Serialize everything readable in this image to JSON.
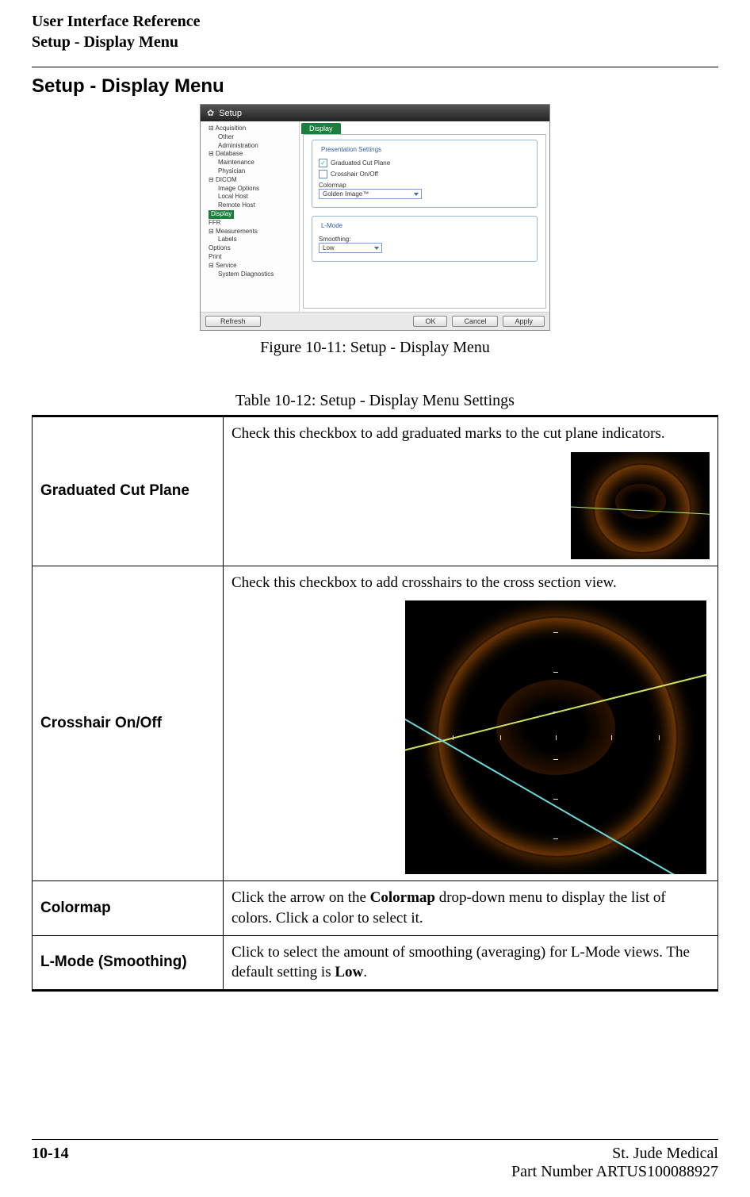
{
  "header": {
    "line1": "User Interface Reference",
    "line2": "Setup - Display Menu"
  },
  "section_heading": "Setup - Display Menu",
  "dialog": {
    "title": "Setup",
    "tree": {
      "acquisition": "Acquisition",
      "other": "Other",
      "administration": "Administration",
      "database": "Database",
      "maintenance": "Maintenance",
      "physician": "Physician",
      "dicom": "DICOM",
      "image_options": "Image Options",
      "local_host": "Local Host",
      "remote_host": "Remote Host",
      "display": "Display",
      "ffr": "FFR",
      "measurements": "Measurements",
      "labels": "Labels",
      "options": "Options",
      "print": "Print",
      "service": "Service",
      "system_diagnostics": "System Diagnostics"
    },
    "tab_label": "Display",
    "presentation_legend": "Presentation Settings",
    "chk_graduated": "Graduated Cut Plane",
    "chk_crosshair": "Crosshair On/Off",
    "colormap_label": "Colormap",
    "colormap_value": "Golden Image™",
    "lmode_legend": "L-Mode",
    "smoothing_label": "Smoothing:",
    "smoothing_value": "Low",
    "btn_refresh": "Refresh",
    "btn_ok": "OK",
    "btn_cancel": "Cancel",
    "btn_apply": "Apply"
  },
  "figure_caption": "Figure 10-11:  Setup - Display Menu",
  "table_caption": "Table 10-12:  Setup - Display Menu Settings",
  "rows": {
    "graduated": {
      "label": "Graduated Cut Plane",
      "desc": "Check this checkbox to add graduated marks to the cut plane indicators."
    },
    "crosshair": {
      "label": "Crosshair On/Off",
      "desc": "Check this checkbox to add crosshairs to the cross section view."
    },
    "colormap": {
      "label": "Colormap",
      "desc_pre": "Click the arrow on the ",
      "desc_bold": "Colormap",
      "desc_post": " drop-down menu to display the list of colors. Click a color to select it."
    },
    "lmode": {
      "label": "L-Mode (Smoothing)",
      "desc_pre": "Click to select the amount of smoothing (averaging) for L-Mode views. The default setting is ",
      "desc_bold": "Low",
      "desc_post": "."
    }
  },
  "footer": {
    "page": "10-14",
    "company": "St. Jude Medical",
    "part": "Part Number ARTUS100088927"
  }
}
